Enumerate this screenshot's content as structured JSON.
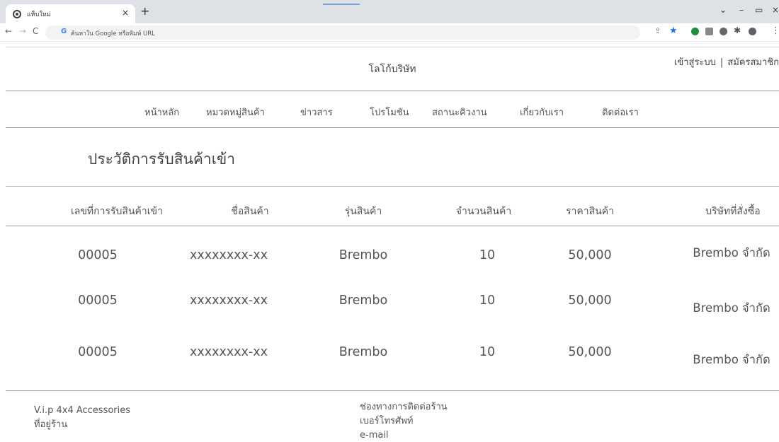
{
  "browser": {
    "tab_title": "แท็บใหม่",
    "tab_close": "×",
    "new_tab": "+",
    "omnibox_placeholder": "ค้นหาใน Google หรือพิมพ์ URL",
    "window_controls": [
      "⌄",
      "–",
      "▭",
      "×"
    ]
  },
  "header": {
    "logo_text": "โลโก้บริษัท",
    "login": "เข้าสู่ระบบ",
    "separator": "|",
    "register": "สมัครสมาชิก"
  },
  "nav": {
    "items": [
      {
        "label": "หน้าหลัก"
      },
      {
        "label": "หมวดหมู่สินค้า"
      },
      {
        "label": "ข่าวสาร"
      },
      {
        "label": "โปรโมชัน"
      },
      {
        "label": "สถานะคิวงาน"
      },
      {
        "label": "เกี่ยวกับเรา"
      },
      {
        "label": "ติดต่อเรา"
      }
    ]
  },
  "main": {
    "title": "ประวัติการรับสินค้าเข้า",
    "table": {
      "headers": [
        "เลขที่การรับสินค้าเข้า",
        "ชื่อสินค้า",
        "รุ่นสินค้า",
        "จำนวนสินค้า",
        "ราคาสินค้า",
        "บริษัทที่สั่งซื้อ"
      ],
      "rows": [
        [
          "00005",
          "xxxxxxxx-xx",
          "Brembo",
          "10",
          "50,000",
          "Brembo จำกัด"
        ],
        [
          "00005",
          "xxxxxxxx-xx",
          "Brembo",
          "10",
          "50,000",
          "Brembo จำกัด"
        ],
        [
          "00005",
          "xxxxxxxx-xx",
          "Brembo",
          "10",
          "50,000",
          "Brembo จำกัด"
        ]
      ]
    }
  },
  "footer": {
    "store_name": "V.i.p 4x4 Accessories",
    "address_label": "ที่อยู่ร้าน",
    "contact_title": "ช่องทางการติดต่อร้าน",
    "phone_label": "เบอร์โทรศัพท์",
    "email_label": "e-mail"
  }
}
